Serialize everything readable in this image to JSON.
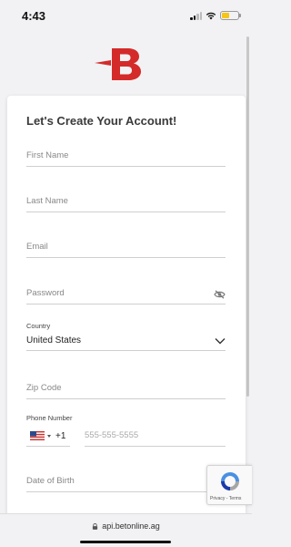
{
  "status_bar": {
    "time": "4:43",
    "battery_level": 0.45,
    "battery_color": "#f5c518"
  },
  "brand": {
    "accent_color": "#d42a2a",
    "logo_icon": "betonline-b-logo"
  },
  "form": {
    "title": "Let's Create Your Account!",
    "first_name": {
      "placeholder": "First Name"
    },
    "last_name": {
      "placeholder": "Last Name"
    },
    "email": {
      "placeholder": "Email"
    },
    "password": {
      "placeholder": "Password",
      "icon": "eye-slash-icon"
    },
    "country": {
      "label": "Country",
      "value": "United States",
      "icon": "chevron-down-icon"
    },
    "zip": {
      "placeholder": "Zip Code"
    },
    "phone": {
      "label": "Phone Number",
      "flag": "us-flag-icon",
      "code": "+1",
      "placeholder": "555-555-5555"
    },
    "dob": {
      "placeholder": "Date of Birth"
    }
  },
  "recaptcha": {
    "terms": "Privacy - Terms"
  },
  "browser": {
    "url": "api.betonline.ag"
  }
}
